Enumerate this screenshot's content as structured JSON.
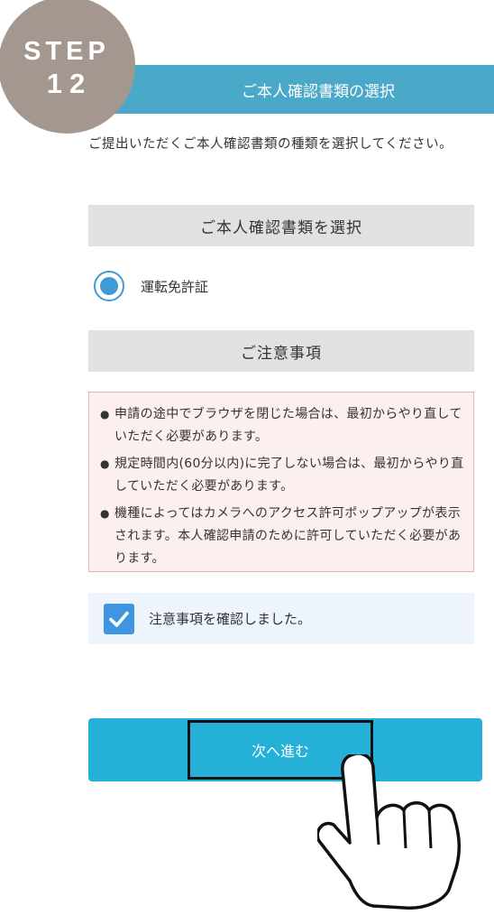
{
  "step_badge": {
    "word": "STEP",
    "number": "12"
  },
  "header": {
    "title": "ご本人確認書類の選択"
  },
  "instruction": "ご提出いただくご本人確認書類の種類を選択してください。",
  "select_section": {
    "title": "ご本人確認書類を選択",
    "options": [
      {
        "label": "運転免許証",
        "selected": true
      }
    ]
  },
  "notes_section": {
    "title": "ご注意事項",
    "items": [
      "申請の途中でブラウザを閉じた場合は、最初からやり直していただく必要があります。",
      "規定時間内(60分以内)に完了しない場合は、最初からやり直していただく必要があります。",
      "機種によってはカメラへのアクセス許可ポップアップが表示されます。本人確認申請のために許可していただく必要があります。"
    ]
  },
  "confirm": {
    "label": "注意事項を確認しました。",
    "checked": true
  },
  "next_button": {
    "label": "次へ進む"
  },
  "colors": {
    "header_bg": "#4aa8c9",
    "badge_bg": "#a49790",
    "button_bg": "#25b0d7",
    "radio_blue": "#3f9bd6",
    "checkbox_blue": "#3f95e0",
    "notes_bg": "#fbf0ee",
    "notes_border": "#e2b5b0",
    "confirm_bg": "#eef4fc"
  }
}
